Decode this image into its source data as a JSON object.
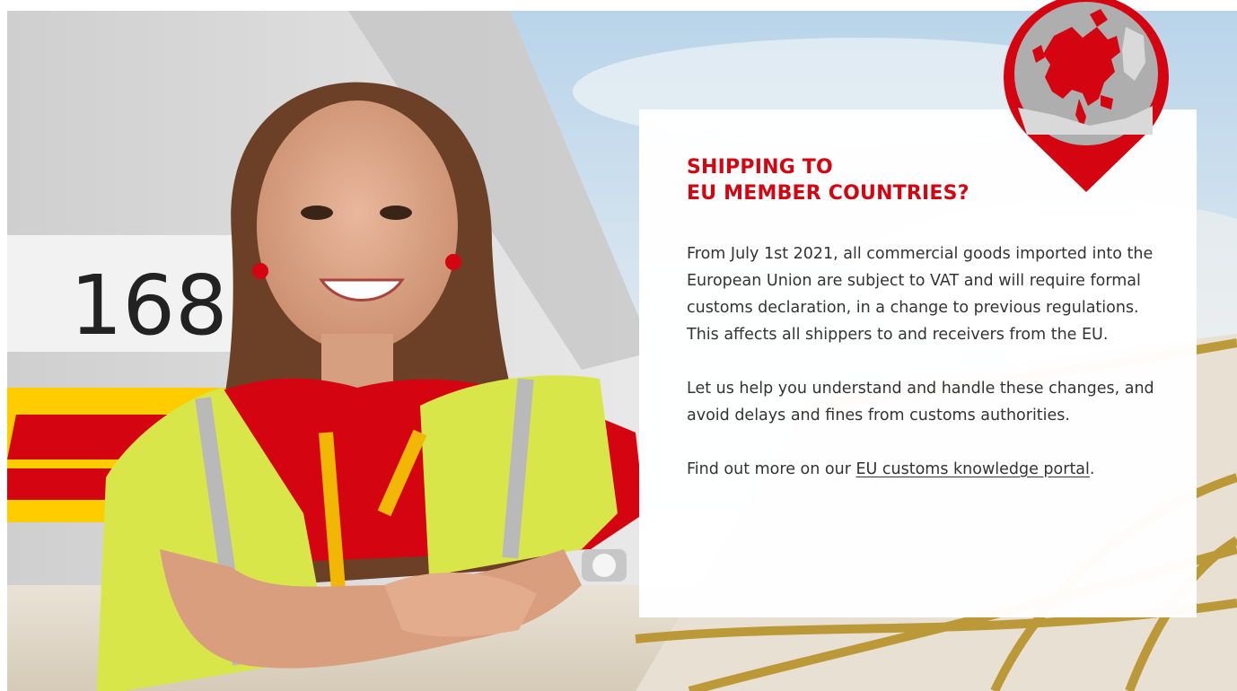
{
  "hero": {
    "photo_sign_number": "1683"
  },
  "card": {
    "title_line1": "SHIPPING TO",
    "title_line2": "EU MEMBER COUNTRIES?",
    "paragraph1": "From July 1st 2021, all commercial goods imported into the European Union are subject to VAT and will require formal customs declaration, in a change to previous regulations. This affects all shippers to and receivers from the EU.",
    "paragraph2": "Let us help you understand and handle these changes, and avoid delays and fines from customs authorities.",
    "paragraph3_prefix": "Find out more on our ",
    "paragraph3_link": "EU customs knowledge portal",
    "paragraph3_suffix": "."
  },
  "pin": {
    "icon": "europe-map-pin-icon"
  },
  "colors": {
    "accent_red": "#d40511",
    "dhl_yellow": "#ffcc00",
    "text": "#333333"
  }
}
